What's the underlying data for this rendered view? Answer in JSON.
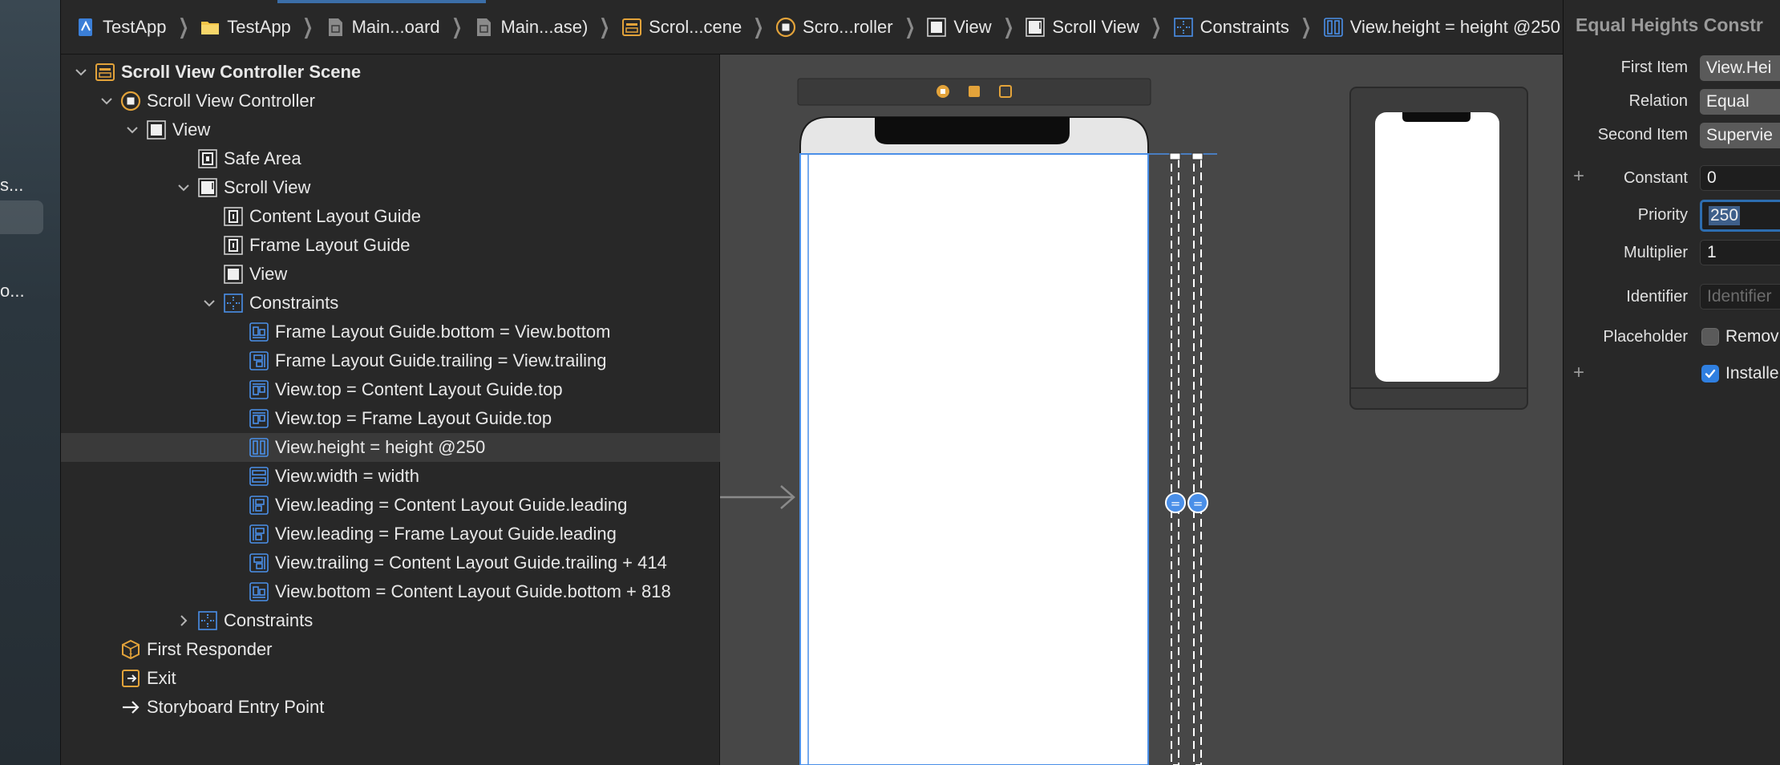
{
  "desktop": {
    "text1": "s...",
    "text2": "o..."
  },
  "breadcrumbs": [
    {
      "label": "TestApp",
      "icon": "project-icon"
    },
    {
      "label": "TestApp",
      "icon": "folder-icon"
    },
    {
      "label": "Main...oard",
      "icon": "storyboard-file-icon"
    },
    {
      "label": "Main...ase)",
      "icon": "storyboard-file-icon"
    },
    {
      "label": "Scrol...cene",
      "icon": "scene-icon"
    },
    {
      "label": "Scro...roller",
      "icon": "view-controller-icon"
    },
    {
      "label": "View",
      "icon": "view-icon"
    },
    {
      "label": "Scroll View",
      "icon": "scroll-view-icon"
    },
    {
      "label": "Constraints",
      "icon": "constraints-icon"
    },
    {
      "label": "View.height = height @250",
      "icon": "height-constraint-icon"
    }
  ],
  "outline": {
    "rows": [
      {
        "label": "Scroll View Controller Scene",
        "icon": "scene-icon",
        "disclosure": "open",
        "bold": true
      },
      {
        "label": "Scroll View Controller",
        "icon": "view-controller-icon",
        "disclosure": "open"
      },
      {
        "label": "View",
        "icon": "view-icon",
        "disclosure": "open"
      },
      {
        "label": "Safe Area",
        "icon": "safe-area-icon"
      },
      {
        "label": "Scroll View",
        "icon": "scroll-view-icon",
        "disclosure": "open"
      },
      {
        "label": "Content Layout Guide",
        "icon": "layout-guide-icon"
      },
      {
        "label": "Frame Layout Guide",
        "icon": "layout-guide-icon"
      },
      {
        "label": "View",
        "icon": "view-icon"
      },
      {
        "label": "Constraints",
        "icon": "constraints-icon",
        "disclosure": "open"
      },
      {
        "label": "Frame Layout Guide.bottom = View.bottom",
        "icon": "bottom-constraint-icon"
      },
      {
        "label": "Frame Layout Guide.trailing = View.trailing",
        "icon": "trailing-constraint-icon"
      },
      {
        "label": "View.top = Content Layout Guide.top",
        "icon": "top-constraint-icon"
      },
      {
        "label": "View.top = Frame Layout Guide.top",
        "icon": "top-constraint-icon"
      },
      {
        "label": "View.height = height @250",
        "icon": "height-constraint-icon",
        "selected": true
      },
      {
        "label": "View.width = width",
        "icon": "width-constraint-icon"
      },
      {
        "label": "View.leading = Content Layout Guide.leading",
        "icon": "leading-constraint-icon"
      },
      {
        "label": "View.leading = Frame Layout Guide.leading",
        "icon": "leading-constraint-icon"
      },
      {
        "label": "View.trailing = Content Layout Guide.trailing + 414",
        "icon": "trailing-constraint-icon"
      },
      {
        "label": "View.bottom = Content Layout Guide.bottom + 818",
        "icon": "bottom-constraint-icon"
      },
      {
        "label": "Constraints",
        "icon": "constraints-icon",
        "disclosure": "closed"
      },
      {
        "label": "First Responder",
        "icon": "first-responder-icon"
      },
      {
        "label": "Exit",
        "icon": "exit-icon"
      },
      {
        "label": "Storyboard Entry Point",
        "icon": "entry-arrow-icon"
      }
    ]
  },
  "inspector": {
    "title": "Equal Heights Constr",
    "first_item_label": "First Item",
    "first_item_value": "View.Hei",
    "relation_label": "Relation",
    "relation_value": "Equal",
    "second_item_label": "Second Item",
    "second_item_value": "Supervie",
    "constant_label": "Constant",
    "constant_value": "0",
    "priority_label": "Priority",
    "priority_value": "250",
    "multiplier_label": "Multiplier",
    "multiplier_value": "1",
    "identifier_label": "Identifier",
    "identifier_placeholder": "Identifier",
    "placeholder_label": "Placeholder",
    "placeholder_check_label": "Remov",
    "installed_label": "Installe",
    "placeholder_checked": false,
    "installed_checked": true
  },
  "colors": {
    "accent": "#2f7fe0",
    "selection": "#3a3a3a",
    "constraint_blue": "#4a8fe8",
    "scene_orange": "#e3a33a"
  }
}
